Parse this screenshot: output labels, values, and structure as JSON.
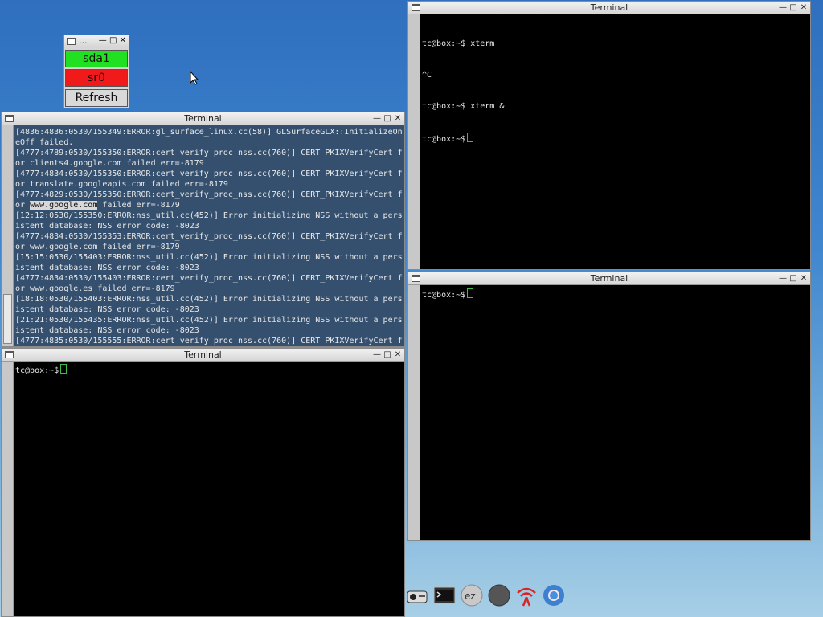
{
  "mount_widget": {
    "title": "...",
    "buttons": [
      {
        "label": "sda1",
        "color": "#21e021"
      },
      {
        "label": "sr0",
        "color": "#f01a1a"
      },
      {
        "label": "Refresh",
        "color": "#d9d9d9"
      }
    ]
  },
  "windows": [
    {
      "title": "Terminal",
      "lines": [
        "[4836:4836:0530/155349:ERROR:gl_surface_linux.cc(58)] GLSurfaceGLX::InitializeOn",
        "eOff failed.",
        "[4777:4789:0530/155350:ERROR:cert_verify_proc_nss.cc(760)] CERT_PKIXVerifyCert f",
        "or clients4.google.com failed err=-8179",
        "[4777:4834:0530/155350:ERROR:cert_verify_proc_nss.cc(760)] CERT_PKIXVerifyCert f",
        "or translate.googleapis.com failed err=-8179",
        "[4777:4829:0530/155350:ERROR:cert_verify_proc_nss.cc(760)] CERT_PKIXVerifyCert f",
        "or www.google.com failed err=-8179",
        "[12:12:0530/155350:ERROR:nss_util.cc(452)] Error initializing NSS without a pers",
        "istent database: NSS error code: -8023",
        "[4777:4834:0530/155353:ERROR:cert_verify_proc_nss.cc(760)] CERT_PKIXVerifyCert f",
        "or www.google.com failed err=-8179",
        "[15:15:0530/155403:ERROR:nss_util.cc(452)] Error initializing NSS without a pers",
        "istent database: NSS error code: -8023",
        "[4777:4834:0530/155403:ERROR:cert_verify_proc_nss.cc(760)] CERT_PKIXVerifyCert f",
        "or www.google.es failed err=-8179",
        "[18:18:0530/155403:ERROR:nss_util.cc(452)] Error initializing NSS without a pers",
        "istent database: NSS error code: -8023",
        "[21:21:0530/155435:ERROR:nss_util.cc(452)] Error initializing NSS without a pers",
        "istent database: NSS error code: -8023",
        "[4777:4835:0530/155555:ERROR:cert_verify_proc_nss.cc(760)] CERT_PKIXVerifyCert f"
      ],
      "highlight": "www.google.com"
    },
    {
      "title": "Terminal",
      "prompt": "tc@box:~$"
    },
    {
      "title": "Terminal",
      "lines": [
        "tc@box:~$ xterm",
        "^C",
        "tc@box:~$ xterm &"
      ],
      "prompt": "tc@box:~$"
    },
    {
      "title": "Terminal",
      "prompt": "tc@box:~$"
    }
  ],
  "window_buttons": {
    "minimize": "—",
    "maximize": "□",
    "close": "✕"
  },
  "dock_icons": [
    "mount-icon",
    "terminal-icon",
    "ezremaster-icon",
    "compass-icon",
    "wifi-icon",
    "chromium-icon"
  ]
}
